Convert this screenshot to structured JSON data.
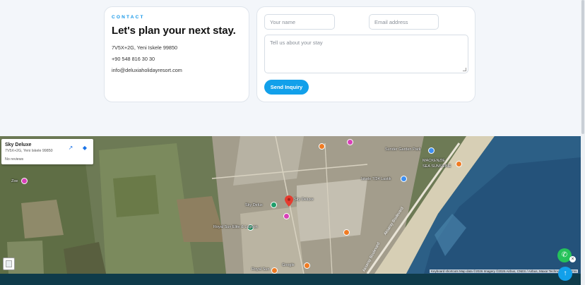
{
  "contact": {
    "eyebrow": "CONTACT",
    "headline": "Let's plan your next stay.",
    "address": "7V5X+2G, Yeni Iskele 99850",
    "phone": "+90 548 816 30 30",
    "email": "info@deluxiaholidayresort.com"
  },
  "form": {
    "name_placeholder": "Your name",
    "email_placeholder": "Email address",
    "message_placeholder": "Tell us about your stay",
    "submit_label": "Send Inquiry"
  },
  "map": {
    "place_card": {
      "title": "Sky Deluxe",
      "address": "7V5X+2G, Yeni Iskele 99850",
      "reviews": "No reviews",
      "open_icon": "external-link-icon",
      "directions_icon": "directions-icon"
    },
    "labels": {
      "zoe": "Zoe",
      "sky_deluxe_1": "Sky Delux",
      "sky_deluxe_2": "Sky Deluxe",
      "royal_sun": "Royal Sun Elite & Lagoon",
      "royal_sun_2": "Royal Sun",
      "google": "Google",
      "iskele": "Iskele 7/24 Lastik",
      "mackenzie": "MACKENZIE",
      "sunshine": "SEA SUNSHINE",
      "garden": "Sunder Garden Park",
      "road_1": "Aksaray Boulevard",
      "road_2": "Aksaray Boulevard"
    },
    "attribution": "Keyboard shortcuts  Map data ©2026 Imagery ©2026 Airbus, CNES / Airbus, Maxar Technologies  Terms"
  },
  "fab": {
    "whatsapp_icon": "whatsapp-icon",
    "close_icon": "close-icon",
    "back_to_top_icon": "arrow-up-icon"
  }
}
